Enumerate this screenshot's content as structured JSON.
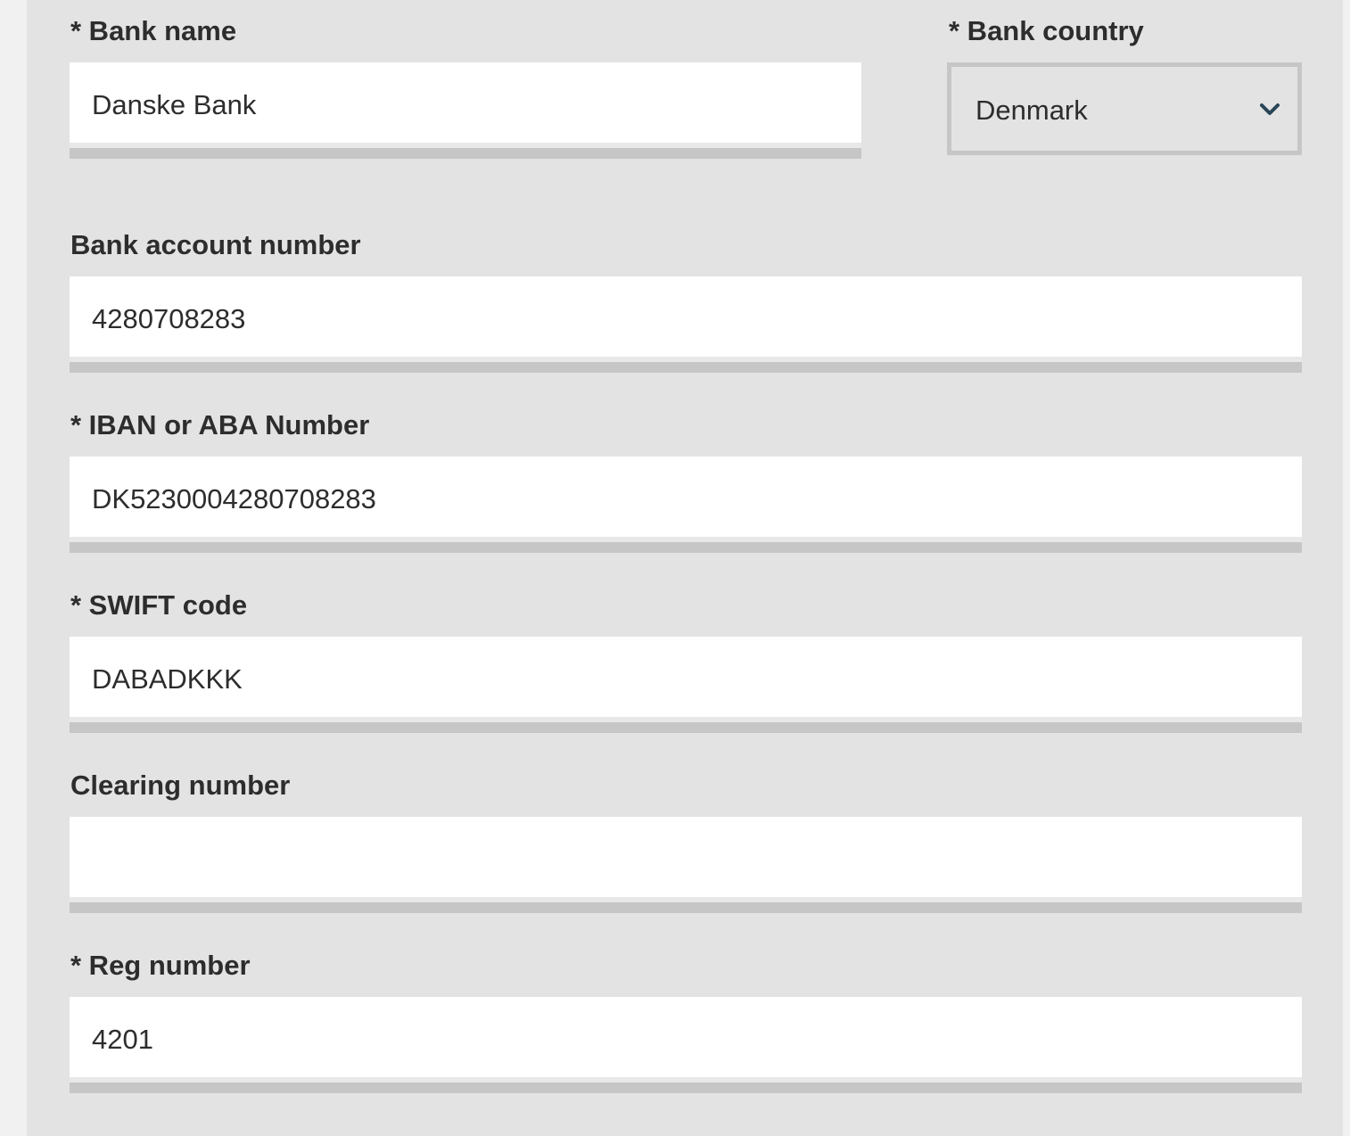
{
  "form": {
    "bank_name": {
      "label": "* Bank name",
      "value": "Danske Bank"
    },
    "bank_country": {
      "label": "* Bank country",
      "value": "Denmark",
      "icon": "chevron-down-icon"
    },
    "account_number": {
      "label": "Bank account number",
      "value": "4280708283"
    },
    "iban": {
      "label": "* IBAN or ABA Number",
      "value": "DK5230004280708283"
    },
    "swift": {
      "label": "* SWIFT code",
      "value": "DABADKKK"
    },
    "clearing": {
      "label": "Clearing number",
      "value": ""
    },
    "reg": {
      "label": "* Reg number",
      "value": "4201"
    }
  },
  "colors": {
    "panel_background": "#e3e3e3",
    "page_background": "#f1f1f1",
    "input_background": "#ffffff",
    "input_underline": "#c6c6c6",
    "text": "#2d2d2d",
    "chevron": "#2a4558"
  }
}
